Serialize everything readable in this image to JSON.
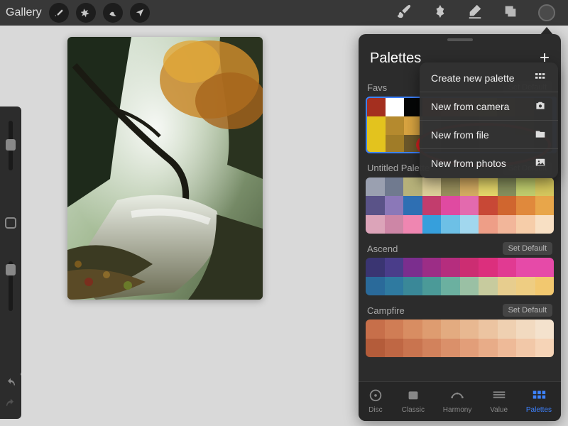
{
  "topbar": {
    "gallery": "Gallery"
  },
  "panel": {
    "title": "Palettes",
    "tabs": [
      {
        "id": "disc",
        "label": "Disc"
      },
      {
        "id": "classic",
        "label": "Classic"
      },
      {
        "id": "harmony",
        "label": "Harmony"
      },
      {
        "id": "value",
        "label": "Value"
      },
      {
        "id": "palettes",
        "label": "Palettes",
        "active": true
      }
    ]
  },
  "dropdown": {
    "items": [
      {
        "id": "new-palette",
        "label": "Create new palette",
        "icon": "grid"
      },
      {
        "id": "new-camera",
        "label": "New from camera",
        "icon": "camera"
      },
      {
        "id": "new-file",
        "label": "New from file",
        "icon": "folder"
      },
      {
        "id": "new-photos",
        "label": "New from photos",
        "icon": "photo"
      }
    ]
  },
  "palettes": [
    {
      "name": "Favs",
      "set_default_label": "Set Default",
      "selected": true,
      "rows": [
        [
          "#a42f1f",
          "#ffffff",
          "#050606",
          "#c0392b",
          "#e17055",
          "#b77f4a",
          "#c79b4f",
          "#8b6a2a",
          "#5a4b1e",
          "#2d2d2d"
        ],
        [
          "#e3c31e",
          "#b58a2e",
          "#d9a441",
          "#5a5a5a",
          "#3a3a3a",
          "#2a2a2a",
          "#404040",
          "#3a3a3a",
          "#4b3a1e",
          "#2d2d2d"
        ],
        [
          "#e3c31e",
          "#a07c28",
          "#6b572a",
          "#3d3d3d",
          "#333333",
          "#2a2a2a",
          "#3a3a3a",
          "#3a3a3a",
          "#3a3a3a",
          "#2d2d2d"
        ]
      ]
    },
    {
      "name": "Untitled Palette",
      "set_default_label": "Set Default",
      "rows": [
        [
          "#9aa0b0",
          "#707a8f",
          "#b7b27a",
          "#ded09a",
          "#99905d",
          "#d6ad63",
          "#e6d86a",
          "#87905d",
          "#c2cf6e",
          "#d7c95e"
        ],
        [
          "#5a5388",
          "#8b78b8",
          "#2e6fb3",
          "#c23d6d",
          "#e04aa1",
          "#e36aae",
          "#c84836",
          "#d0662f",
          "#e0893c",
          "#e8a64a"
        ],
        [
          "#dca4b9",
          "#cd86a6",
          "#ef86b1",
          "#369fdc",
          "#6dc0e6",
          "#a1d7ee",
          "#ee9e87",
          "#f2b69a",
          "#f6cda9",
          "#f8e0c4"
        ]
      ]
    },
    {
      "name": "Ascend",
      "set_default_label": "Set Default",
      "rows": [
        [
          "#3a3572",
          "#4a3d8a",
          "#7b2e8e",
          "#9c2d86",
          "#b52d7e",
          "#cc2d72",
          "#dc2f7d",
          "#e13a92",
          "#e64aa8",
          "#e64aa8"
        ],
        [
          "#2a6a9a",
          "#2f7aa0",
          "#3a8898",
          "#4b9a98",
          "#6bb0a0",
          "#9ac0a4",
          "#c7cb9e",
          "#e7cd8e",
          "#eecd82",
          "#f2c86f"
        ]
      ]
    },
    {
      "name": "Campfire",
      "set_default_label": "Set Default",
      "rows": [
        [
          "#c76f4a",
          "#d07d55",
          "#d88d62",
          "#de9c70",
          "#e3ab80",
          "#e8b891",
          "#ecc4a1",
          "#efd0b1",
          "#f2dac0",
          "#f4e2cd"
        ],
        [
          "#b45c3a",
          "#bf6744",
          "#c9744f",
          "#d2825c",
          "#da906a",
          "#e29e79",
          "#e8ac88",
          "#eeba98",
          "#f2c8a8",
          "#f6d4b7"
        ]
      ]
    }
  ],
  "annotation": {
    "target": "new-photos"
  }
}
